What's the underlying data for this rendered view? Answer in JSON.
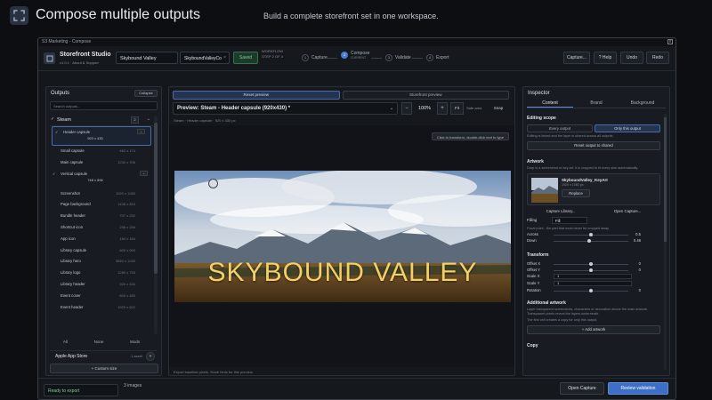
{
  "page": {
    "title": "Compose multiple outputs",
    "subtitle": "Build a complete storefront set in one workspace."
  },
  "window": {
    "title": "S3 Marketing - Compose",
    "close": "x"
  },
  "toolbar": {
    "app_name": "Storefront Studio",
    "app_version": "v1.0.1 · About & Support",
    "project_name": "Skybound Valley",
    "project_slug": "SkyboundValleyCo",
    "slug_clear": "×",
    "saved_label": "Saved",
    "capture_label": "Capture...",
    "help_label": "? Help",
    "undo_label": "Undo",
    "redo_label": "Redo"
  },
  "workflow": {
    "label": "WORKFLOW",
    "step_label": "STEP 2 OF 4",
    "steps": [
      {
        "num": "1",
        "label": "Capture",
        "sub": ""
      },
      {
        "num": "2",
        "label": "Compose",
        "sub": "CURRENT"
      },
      {
        "num": "3",
        "label": "Validate",
        "sub": ""
      },
      {
        "num": "4",
        "label": "Export",
        "sub": ""
      }
    ]
  },
  "outputs": {
    "title": "Outputs",
    "collapse_label": "Collapse",
    "search_placeholder": "Search outputs...",
    "steam": {
      "check": "✓",
      "name": "Steam",
      "count": "2",
      "chevron": "⌄",
      "items": [
        {
          "label": "Header capsule",
          "dim": "920 x 430",
          "check": "✓",
          "expand": "⌄"
        },
        {
          "label": "Small capsule",
          "dim": "462 x 174"
        },
        {
          "label": "Main capsule",
          "dim": "1232 x 706"
        },
        {
          "label": "Vertical capsule",
          "dim": "748 x 896",
          "check": "✓",
          "expand": "⌄"
        },
        {
          "label": "Screenshot",
          "dim": "1920 x 1080"
        },
        {
          "label": "Page background",
          "dim": "1438 x 810"
        },
        {
          "label": "Bundle header",
          "dim": "707 x 232"
        },
        {
          "label": "Shortcut icon",
          "dim": "256 x 256"
        },
        {
          "label": "App icon",
          "dim": "184 x 184"
        },
        {
          "label": "Library capsule",
          "dim": "600 x 900"
        },
        {
          "label": "Library hero",
          "dim": "3840 x 1240"
        },
        {
          "label": "Library logo",
          "dim": "1280 x 720"
        },
        {
          "label": "Library header",
          "dim": "920 x 430"
        },
        {
          "label": "Event cover",
          "dim": "800 x 450"
        },
        {
          "label": "Event header",
          "dim": "1920 x 622"
        }
      ]
    },
    "select": {
      "all": "All",
      "none": "None",
      "mods": "Mods"
    },
    "apple": {
      "name": "Apple App Store",
      "count": "1 asset",
      "plus": "+"
    },
    "custom_label": "+ Custom size"
  },
  "preview": {
    "tab_reset": "Reset preview",
    "tab_store": "Storefront preview",
    "title": "Preview: Steam - Header capsule (920x430)",
    "title_star": "*",
    "title_caret": "⌄",
    "zoom_minus": "−",
    "zoom": "100%",
    "zoom_plus": "+",
    "fit": "Fit",
    "safe_area": "Safe area",
    "snap": "Snap",
    "path": "Steam · Header capsule · 920 x 430 px",
    "hint": "Click to transform, double-click text to type",
    "art_title": "SKYBOUND VALLEY",
    "foot": "Export baseline pixels. Scroll hints for this preview."
  },
  "inspector": {
    "title": "Inspector",
    "tabs": [
      "Content",
      "Brand",
      "Background"
    ],
    "scope_title": "Editing scope",
    "scope_every": "Every output",
    "scope_only": "Only this output",
    "scope_hint": "Editing is linked and the layer is shared across all outputs.",
    "reset_label": "Reset output to shared",
    "artwork_title": "Artwork",
    "artwork_hint": "Drop in a screenshot or key art. It is cropped to fit every size automatically.",
    "art_name": "SkyboundValley_KeyArt",
    "art_meta": "1920 x 1080 px",
    "replace_label": "Replace",
    "capture_library": "Capture Library...",
    "open_capture": "Open Capture...",
    "filling_label": "Filling",
    "filling_value": "Fill",
    "focal_hint": "Focal point - the part that must never be cropped away",
    "across_label": "Across",
    "across_value": "0.5",
    "across_level": 0.5,
    "down_label": "Down",
    "down_value": "0.48",
    "down_level": 0.48,
    "transform_title": "Transform",
    "offset_x_label": "Offset X",
    "offset_x": "0",
    "offset_y_label": "Offset Y",
    "offset_y": "0",
    "scale_x_label": "Scale X",
    "scale_x": "1",
    "scale_y_label": "Scale Y",
    "scale_y": "1",
    "rotation_label": "Rotation",
    "rotation": "0",
    "additional_title": "Additional artwork",
    "additional_hint": "Layer transparent screenshots, characters or decoration above the main artwork. Transparent pixels reveal the layers underneath.",
    "additional_hint2": "The first cell creates a copy for only this output.",
    "add_artwork": "+ Add artwork",
    "copy_title": "Copy"
  },
  "footer": {
    "status": "Ready to export",
    "images": "3 images",
    "open_capture": "Open Capture",
    "review": "Review validation"
  }
}
